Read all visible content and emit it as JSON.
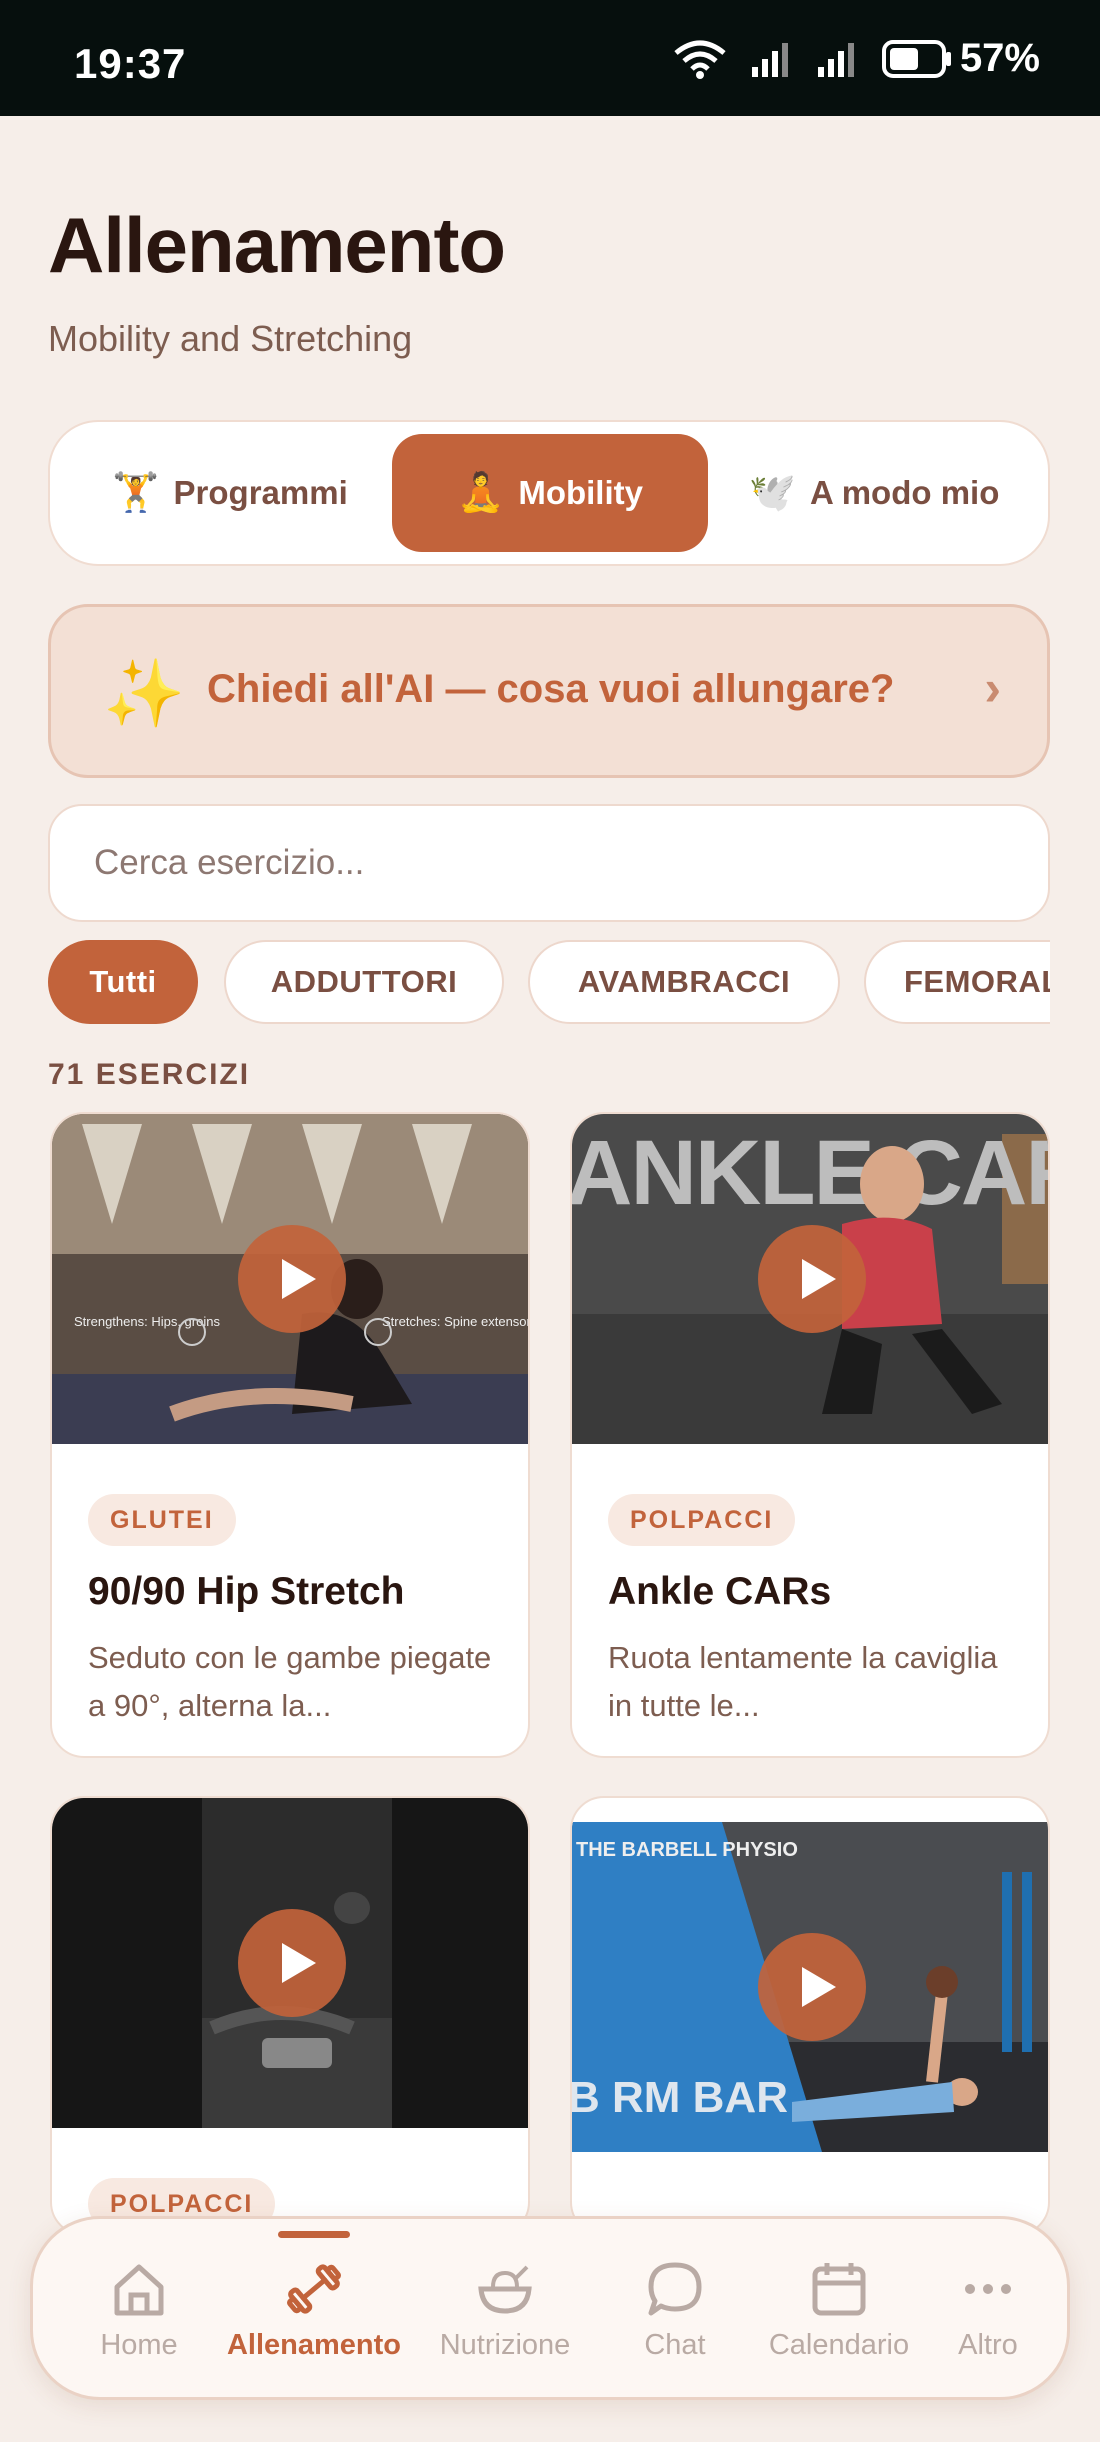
{
  "status_bar": {
    "time": "19:37",
    "battery": "57%"
  },
  "header": {
    "title": "Allenamento",
    "subtitle": "Mobility and Stretching"
  },
  "tabs": [
    {
      "label": "Programmi",
      "icon": "🏋️",
      "icon_name": "weightlifter-icon",
      "active": false
    },
    {
      "label": "Mobility",
      "icon": "🧘",
      "icon_name": "meditation-icon",
      "active": true
    },
    {
      "label": "A modo mio",
      "icon": "🕊️",
      "icon_name": "bird-icon",
      "active": false
    }
  ],
  "ai_banner": {
    "icon": "✨",
    "text": "Chiedi all'AI — cosa vuoi allungare?",
    "chevron": "›"
  },
  "search": {
    "placeholder": "Cerca esercizio..."
  },
  "filters": [
    {
      "label": "Tutti",
      "active": true
    },
    {
      "label": "ADDUTTORI",
      "active": false
    },
    {
      "label": "AVAMBRACCI",
      "active": false
    },
    {
      "label": "FEMORALI",
      "active": false
    }
  ],
  "count_label": "71 ESERCIZI",
  "exercises": [
    {
      "tag": "GLUTEI",
      "title": "90/90 Hip Stretch",
      "desc": "Seduto con le gambe piegate a 90°, alterna la...",
      "overlay_left": "Strengthens: Hips, groins",
      "overlay_right": "Stretches: Spine extensors, Trunk rotators"
    },
    {
      "tag": "POLPACCI",
      "title": "Ankle CARs",
      "desc": "Ruota lentamente la caviglia in tutte le...",
      "overlay_text": "ANKLE CARS"
    },
    {
      "tag": "POLPACCI",
      "title": "",
      "desc": ""
    },
    {
      "tag": "",
      "title": "",
      "desc": "",
      "overlay_text": "B RM BAR",
      "overlay_logo": "THE BARBELL PHYSIO"
    }
  ],
  "nav": [
    {
      "label": "Home",
      "icon_name": "home-icon",
      "active": false
    },
    {
      "label": "Allenamento",
      "icon_name": "dumbbell-icon",
      "active": true
    },
    {
      "label": "Nutrizione",
      "icon_name": "salad-bowl-icon",
      "active": false
    },
    {
      "label": "Chat",
      "icon_name": "chat-bubble-icon",
      "active": false
    },
    {
      "label": "Calendario",
      "icon_name": "calendar-icon",
      "active": false
    },
    {
      "label": "Altro",
      "icon_name": "more-dots-icon",
      "active": false
    }
  ],
  "colors": {
    "accent": "#c2633b",
    "background": "#f6eee9",
    "text": "#2a1610",
    "muted": "#7d5d50"
  }
}
